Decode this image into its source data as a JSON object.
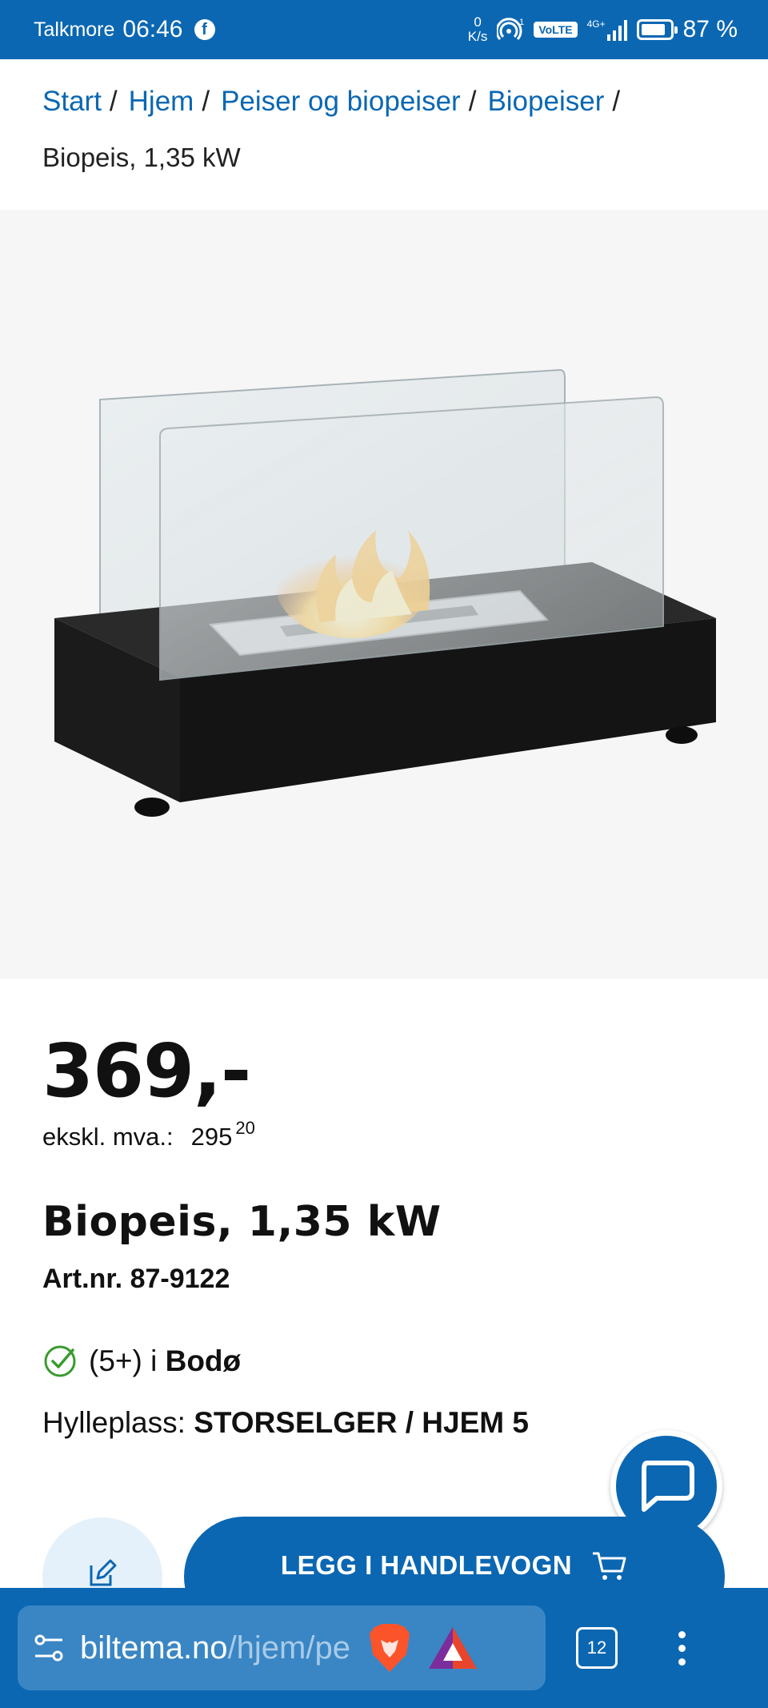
{
  "status_bar": {
    "carrier": "Talkmore",
    "time": "06:46",
    "net_speed_value": "0",
    "net_speed_unit": "K/s",
    "volte": "VoLTE",
    "network": "4G+",
    "battery": "87 %",
    "battery_level": 0.87,
    "app_icon": "facebook-icon"
  },
  "breadcrumb": {
    "items": [
      "Start",
      "Hjem",
      "Peiser og biopeiser",
      "Biopeiser"
    ],
    "separator": "/",
    "current": "Biopeis, 1,35 kW"
  },
  "product": {
    "image_icon": "bioethanol-fireplace-image",
    "price": "369,-",
    "ex_vat_label": "ekskl. mva.:",
    "ex_vat_whole": "295",
    "ex_vat_decimals": "20",
    "title": "Biopeis, 1,35 kW",
    "article_number": "Art.nr. 87-9122",
    "stock_count": "(5+) i",
    "stock_store": "Bodø",
    "shelf_label": "Hylleplass:",
    "shelf_value": "STORSELGER / HJEM 5"
  },
  "actions": {
    "add_to_cart": "LEGG I HANDLEVOGN",
    "wishlist_icon": "edit-list-icon",
    "chat_icon": "chat-bubble-icon"
  },
  "browser": {
    "url_domain": "biltema.no",
    "url_path": "/hjem/pe",
    "tab_count": "12"
  },
  "colors": {
    "brand_blue": "#0b67b2",
    "light_blue": "#e5f1fa",
    "stock_green": "#3a9a2f"
  }
}
